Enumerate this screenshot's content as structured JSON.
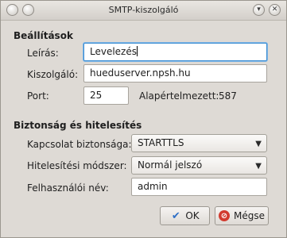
{
  "window": {
    "title": "SMTP-kiszolgáló"
  },
  "settings": {
    "heading": "Beállítások",
    "description": {
      "label": "Leírás:",
      "value": "Levelezés"
    },
    "server": {
      "label": "Kiszolgáló:",
      "value": "hueduserver.npsh.hu"
    },
    "port": {
      "label": "Port:",
      "value": "25",
      "default_label": "Alapértelmezett:",
      "default_value": "587"
    }
  },
  "security": {
    "heading": "Biztonság és hitelesítés",
    "connection_security": {
      "label": "Kapcsolat biztonsága:",
      "value": "STARTTLS"
    },
    "auth_method": {
      "label": "Hitelesítési módszer:",
      "value": "Normál jelszó"
    },
    "username": {
      "label": "Felhasználói név:",
      "value": "admin"
    }
  },
  "buttons": {
    "ok": "OK",
    "cancel": "Mégse"
  },
  "icons": {
    "ok": "check-icon",
    "cancel": "cancel-icon",
    "minimize": "chevron-down-icon",
    "close": "close-icon",
    "window_menu": "circle-icon"
  }
}
